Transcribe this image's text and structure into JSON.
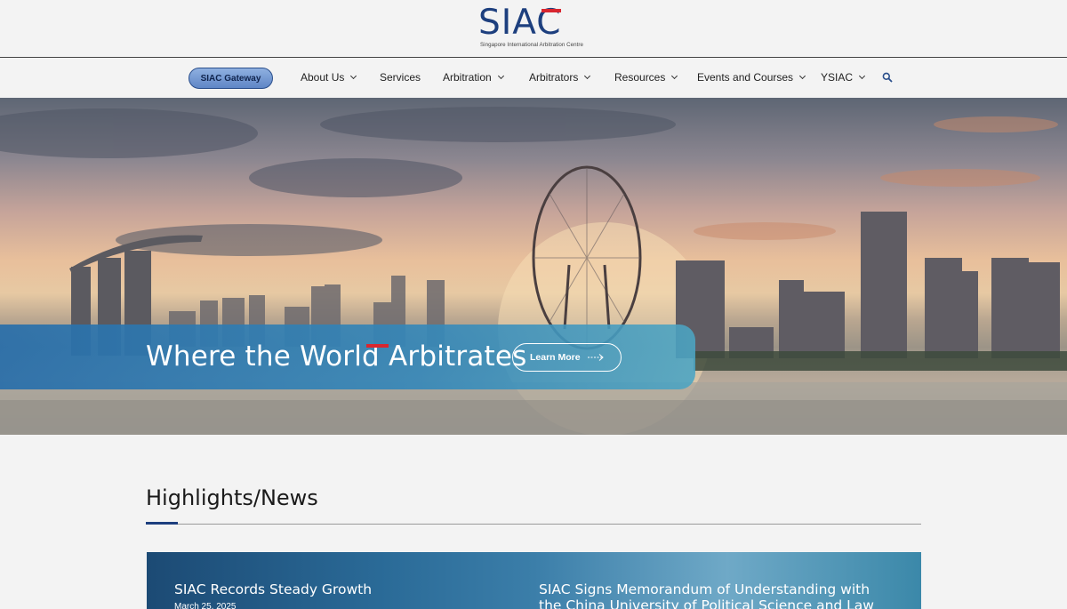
{
  "logo": {
    "word": "SIAC",
    "subtitle": "Singapore International Arbitration Centre"
  },
  "nav": {
    "gateway": "SIAC Gateway",
    "items": [
      {
        "label": "About Us",
        "has_menu": true
      },
      {
        "label": "Services",
        "has_menu": false
      },
      {
        "label": "Arbitration",
        "has_menu": true
      },
      {
        "label": "Arbitrators",
        "has_menu": true
      },
      {
        "label": "Resources",
        "has_menu": true
      },
      {
        "label": "Events and Courses",
        "has_menu": true
      },
      {
        "label": "YSIAC",
        "has_menu": true
      }
    ],
    "search_icon": "search-icon"
  },
  "hero": {
    "headline": "Where the World Arbitrates",
    "cta": "Learn More",
    "cta_icon": "arrow-right-icon"
  },
  "highlights": {
    "title": "Highlights/News",
    "items": [
      {
        "title": "SIAC Records Steady Growth",
        "date": "March 25, 2025"
      },
      {
        "title": "SIAC Signs Memorandum of Understanding with the China University of Political Science and Law",
        "date": ""
      }
    ]
  },
  "colors": {
    "brand_navy": "#1d3f7e",
    "brand_red": "#d8262f",
    "banner_blue": "#2f7fb5"
  }
}
